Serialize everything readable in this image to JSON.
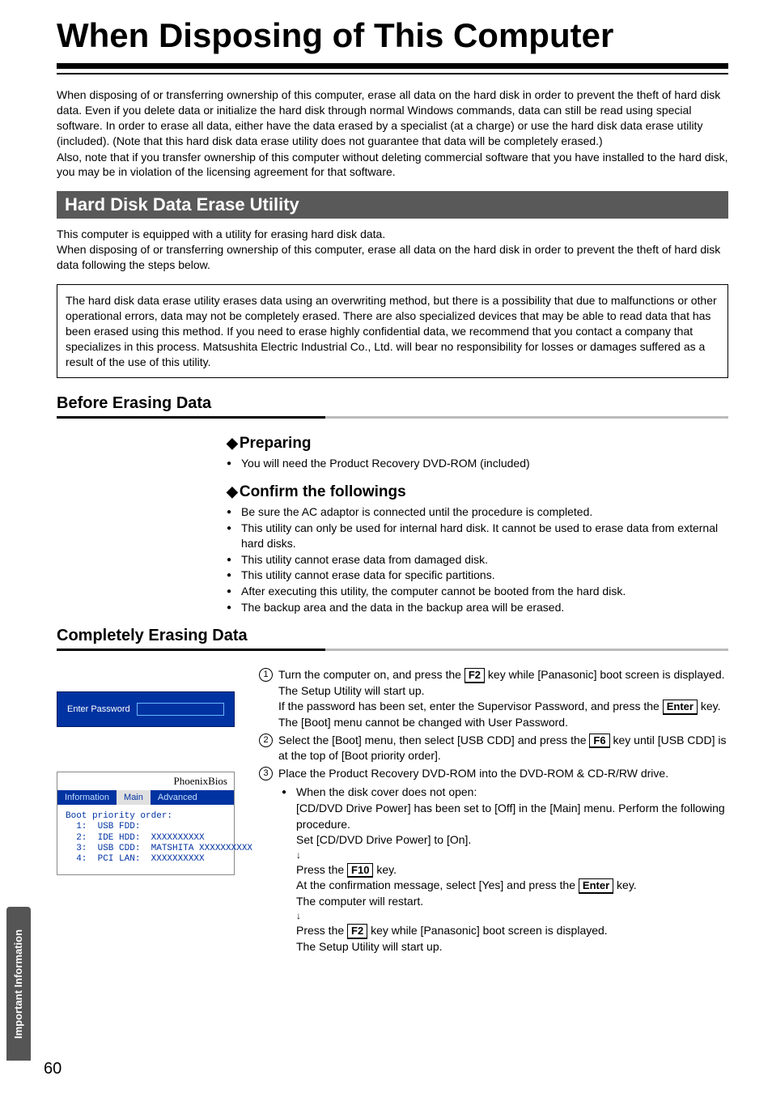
{
  "title": "When Disposing of This Computer",
  "intro": {
    "p1": "When disposing of or transferring ownership of this computer, erase all data on the hard disk in order to prevent the theft of hard disk data. Even if you delete data or initialize the hard disk through normal Windows commands, data can still be read using special software. In order to erase all data, either have the data erased by a specialist (at a charge) or use the hard disk data erase utility (included).  (Note that this hard disk data erase utility does not guarantee that data will be completely erased.)",
    "p2": "Also, note that if you transfer ownership of this computer without deleting commercial software that you have installed to the hard disk, you may be in violation of the licensing agreement for that software."
  },
  "darkbar": "Hard Disk Data Erase Utility",
  "body": {
    "p1": "This computer is equipped with a utility for erasing hard disk data.",
    "p2": "When disposing of or transferring ownership of this computer, erase all data on the hard disk in order to prevent the theft of hard disk data following the steps below."
  },
  "boxed": "The hard disk data erase utility erases data using an overwriting method, but there is a possibility that due to malfunctions or other operational errors, data may not be completely erased. There are also specialized devices that may be able to read data that has been erased using this method. If you need to erase highly confidential data, we recommend that you contact a company that specializes in this process. Matsushita Electric Industrial Co., Ltd. will bear no responsibility for losses or damages suffered as a result of the use of this utility.",
  "before_heading": "Before Erasing Data",
  "preparing": {
    "heading": "Preparing",
    "b1": "You will need the Product Recovery DVD-ROM (included)"
  },
  "confirm": {
    "heading": "Confirm the followings",
    "b1": "Be sure the AC adaptor is connected until the procedure is completed.",
    "b2": "This utility can only be used for internal hard disk.  It cannot be used to erase data from external hard disks.",
    "b3": "This utility cannot erase data from damaged disk.",
    "b4": "This utility cannot erase data for specific partitions.",
    "b5": "After executing this utility, the computer cannot be booted from the hard disk.",
    "b6": "The backup area and the data in the backup area will be erased."
  },
  "completely_heading": "Completely Erasing Data",
  "password_prompt": "Enter Password",
  "bios": {
    "brand": "PhoenixBios",
    "tab1": "Information",
    "tab2": "Main",
    "tab3": "Advanced",
    "line0": "Boot priority order:",
    "line1": "  1:  USB FDD:",
    "line2": "  2:  IDE HDD:  XXXXXXXXXX",
    "line3": "  3:  USB CDD:  MATSHITA XXXXXXXXXX",
    "line4": "  4:  PCI LAN:  XXXXXXXXXX"
  },
  "steps": {
    "s1a": "Turn the computer on, and press the ",
    "s1key1": "F2",
    "s1b": " key while [Panasonic] boot screen is displayed.",
    "s1c": "The Setup Utility will start up.",
    "s1d": "If the password has been set, enter the Supervisor Password, and press the ",
    "s1key2": "Enter",
    "s1e": " key. The [Boot] menu cannot be changed with User Password.",
    "s2a": "Select the [Boot] menu, then select [USB CDD] and press the ",
    "s2key1": "F6",
    "s2b": " key until [USB CDD] is at the top of [Boot priority order].",
    "s3a": "Place the Product Recovery DVD-ROM into the DVD-ROM & CD-R/RW drive.",
    "s3b": "When the disk cover does not open:",
    "s3c": "[CD/DVD Drive Power] has been set to [Off] in the [Main] menu. Perform the following procedure.",
    "s3d": "Set [CD/DVD Drive Power] to [On].",
    "s3e": "Press the ",
    "s3key1": "F10",
    "s3f": " key.",
    "s3g": "At the confirmation message, select [Yes] and press the ",
    "s3key2": "Enter",
    "s3h": " key.",
    "s3i": "The computer will restart.",
    "s3j": "Press the ",
    "s3key3": "F2",
    "s3k": " key while [Panasonic] boot screen is displayed.",
    "s3l": "The Setup Utility will start up."
  },
  "side_tab": "Important Information",
  "page_number": "60"
}
